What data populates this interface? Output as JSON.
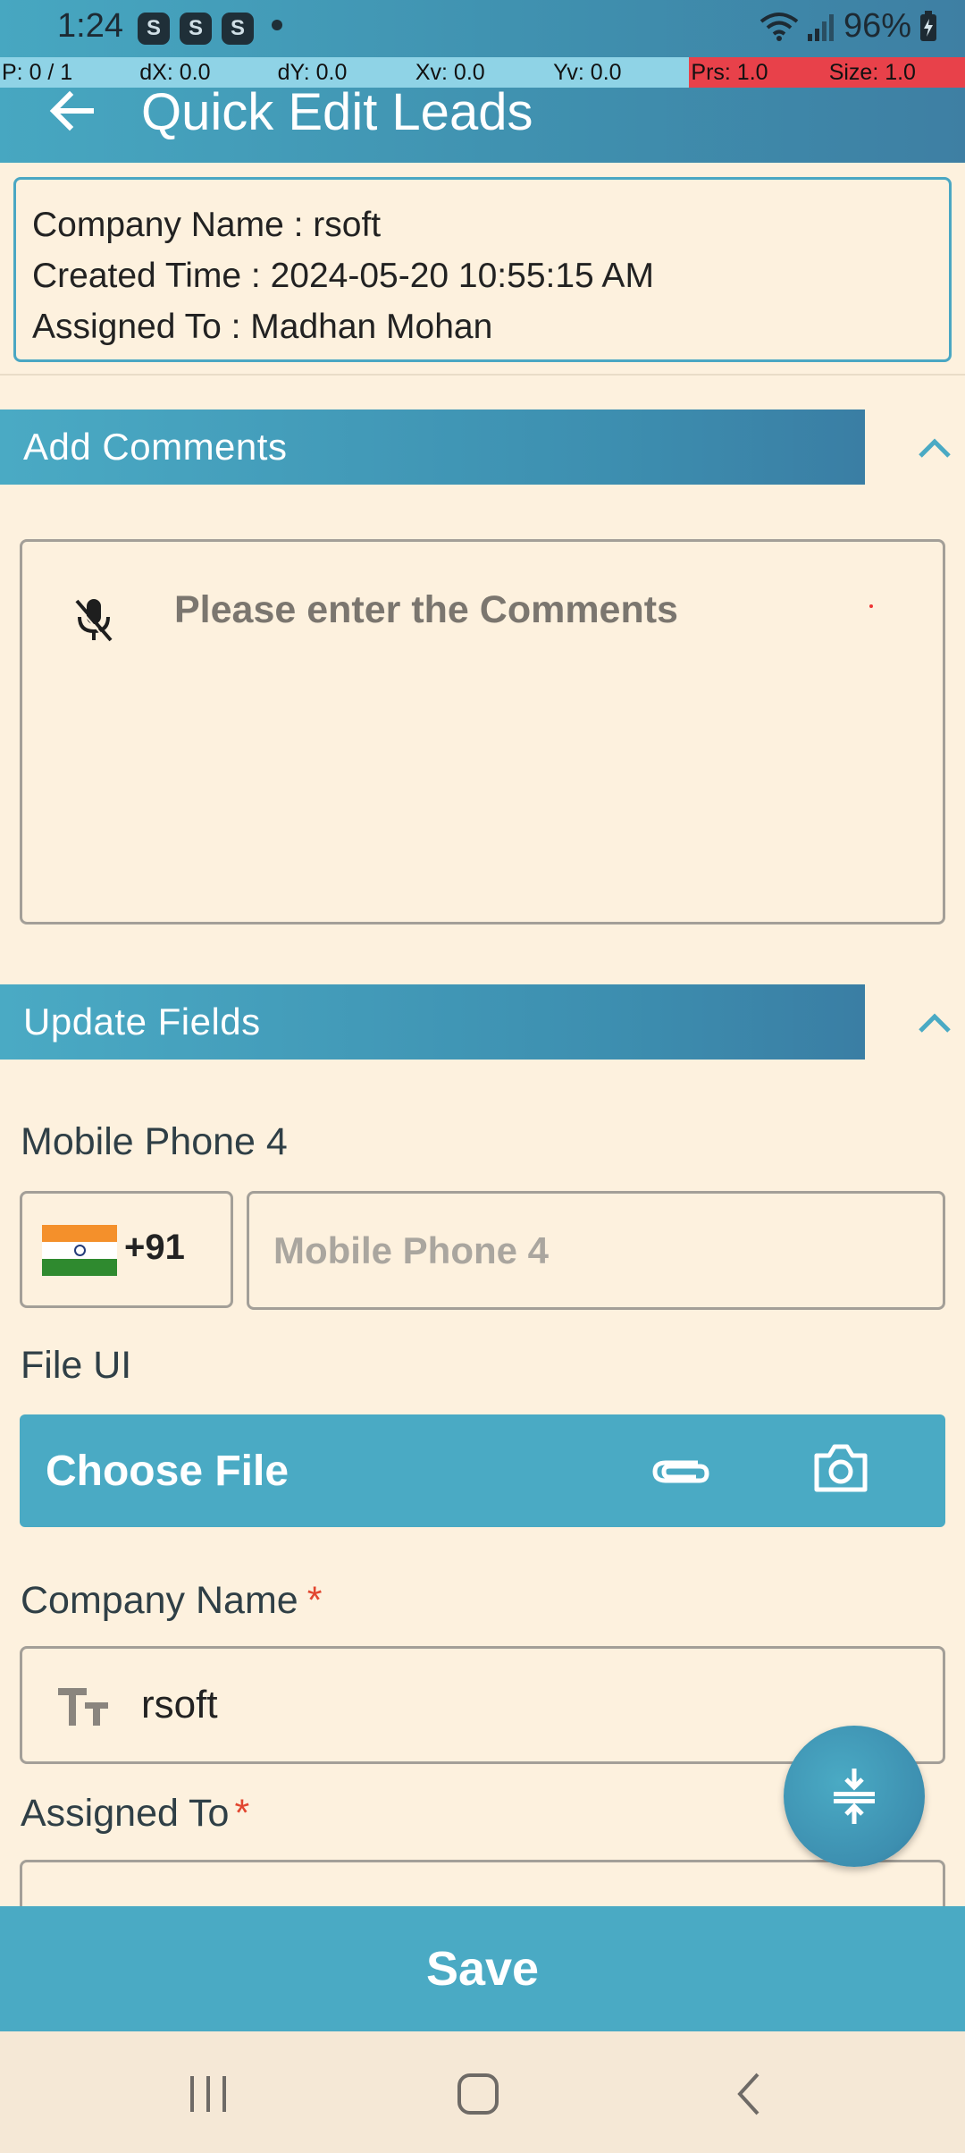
{
  "status_bar": {
    "time": "1:24",
    "notification_icons": [
      "S",
      "S",
      "S"
    ],
    "battery": "96%"
  },
  "debug": {
    "pointer": "P: 0 / 1",
    "dx": "dX: 0.0",
    "dy": "dY: 0.0",
    "xv": "Xv: 0.0",
    "yv": "Yv: 0.0",
    "prs": "Prs: 1.0",
    "size": "Size: 1.0"
  },
  "header": {
    "title": "Quick Edit Leads"
  },
  "info": {
    "company": "Company Name  : rsoft",
    "created": "Created Time : 2024-05-20 10:55:15 AM",
    "assigned": "Assigned To : Madhan Mohan"
  },
  "comments": {
    "section_title": "Add Comments",
    "placeholder": "Please enter the Comments"
  },
  "update_fields": {
    "section_title": "Update Fields",
    "mobile_label": "Mobile Phone 4",
    "country_code": "+91",
    "mobile_placeholder": "Mobile Phone 4",
    "file_label": "File UI",
    "file_button": "Choose File",
    "company_label": "Company Name",
    "company_required": "*",
    "company_value": "rsoft",
    "assigned_label": "Assigned To",
    "assigned_required": "*"
  },
  "actions": {
    "save": "Save"
  },
  "colors": {
    "accent": "#4aaac4",
    "background": "#fdf1de",
    "required": "#e2462f"
  }
}
